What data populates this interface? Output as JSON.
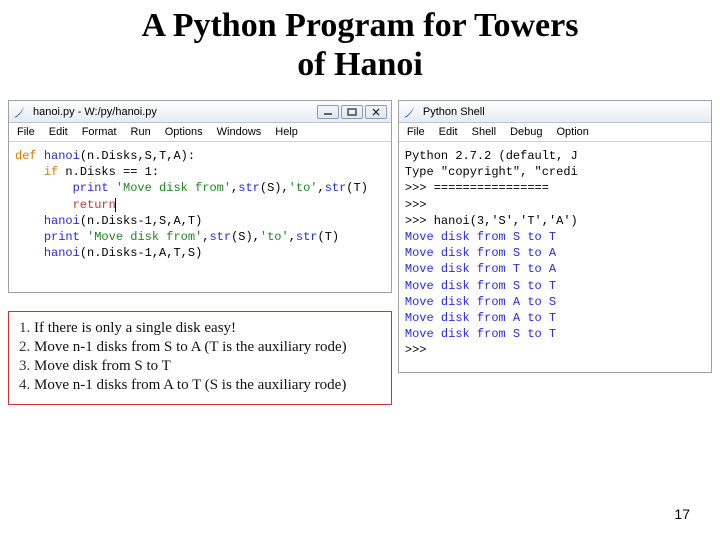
{
  "title_line1": "A Python Program for Towers",
  "title_line2": "of Hanoi",
  "page_number": "17",
  "editor": {
    "title": "hanoi.py - W:/py/hanoi.py",
    "menus": [
      "File",
      "Edit",
      "Format",
      "Run",
      "Options",
      "Windows",
      "Help"
    ],
    "tok": {
      "def": "def",
      "if": "if",
      "return": "return",
      "hanoi": "hanoi",
      "print": "print",
      "str": "str",
      "lp": "(",
      "rp": ")",
      "col": ":",
      "com": ",",
      "sp": " ",
      "nd": "n.Disks",
      "S": "S",
      "T": "T",
      "A": "A",
      "eq": "==",
      "one": "1",
      "minus1": "n.Disks-1",
      "smove": "'Move disk from'",
      "sto": "'to'"
    }
  },
  "shell": {
    "title": "Python Shell",
    "menus": [
      "File",
      "Edit",
      "Shell",
      "Debug",
      "Option"
    ],
    "banner1": "Python 2.7.2 (default, J",
    "banner2": "Type \"copyright\", \"credi",
    "prompt": ">>>",
    "divider": "================",
    "call": "hanoi(3,'S','T','A')",
    "lines": [
      "Move disk from S to T",
      "Move disk from S to A",
      "Move disk from T to A",
      "Move disk from S to T",
      "Move disk from A to S",
      "Move disk from A to T",
      "Move disk from S to T"
    ]
  },
  "algo": {
    "l1": "If there is only a single disk   easy!",
    "l2": "Move n-1 disks from S to A (T is the auxiliary rode)",
    "l3": "Move disk from S to T",
    "l4": "Move n-1 disks from A to T (S is the auxiliary rode)"
  }
}
